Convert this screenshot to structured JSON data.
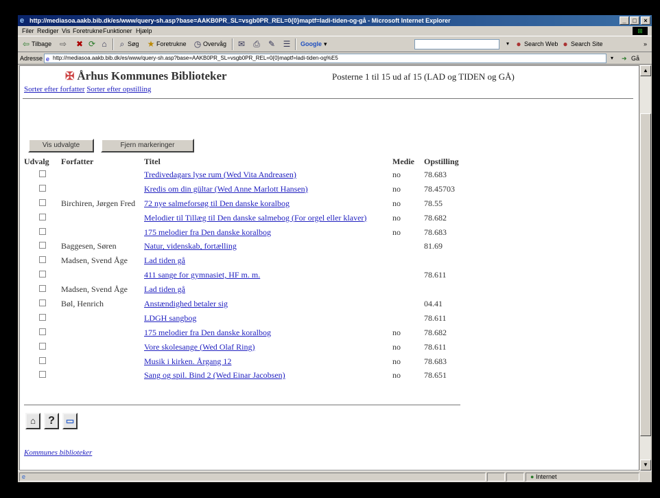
{
  "window": {
    "title": "http://mediasoa.aakb.bib.dk/es/www/query-sh.asp?base=AAKB0PR_SL=vsgb0PR_REL=0{0}maptf=ladi-tiden-og-gå - Microsoft Internet Explorer",
    "min": "_",
    "max": "□",
    "close": "×"
  },
  "menu": [
    "Filer",
    "Rediger",
    "Vis",
    "Foretrukne",
    "Funktioner",
    "Hjælp"
  ],
  "toolbar": {
    "back": "Tilbage",
    "search": "Søg",
    "favorites": "Foretrukne",
    "media": "Overvåg",
    "google": "Google",
    "search_web": "Search Web",
    "search_site": "Search Site"
  },
  "address": {
    "label": "Adresse",
    "url": "http://mediasoa.aakb.bib.dk/es/www/query-sh.asp?base=AAKB0PR_SL=vsgb0PR_REL=0{0}maptf=ladi-tiden-og%E5",
    "go": "Gå"
  },
  "page": {
    "brand": "Århus Kommunes Biblioteker",
    "result_info": "Posterne 1 til 15 ud af 15 (LAD og TIDEN og GÅ)",
    "sort_author": "Sorter efter forfatter",
    "sort_position": "Sorter efter opstilling",
    "btn_show_selected": "Vis udvalgte",
    "btn_remove_marks": "Fjern markeringer",
    "columns": {
      "select": "Udvalg",
      "author": "Forfatter",
      "title": "Titel",
      "media": "Medie",
      "position": "Opstilling"
    },
    "rows": [
      {
        "author": "",
        "title": "Tredivedagars lyse rum (Wed Vita Andreasen)",
        "media": "no",
        "position": "78.683"
      },
      {
        "author": "",
        "title": "Kredis om din gültar (Wed Anne Marlott Hansen)",
        "media": "no",
        "position": "78.45703"
      },
      {
        "author": "Birchiren, Jørgen Fred",
        "title": "72 nye salmeforsøg til Den danske koralbog",
        "media": "no",
        "position": "78.55"
      },
      {
        "author": "",
        "title": "Melodier til Tillæg til Den danske salmebog (For orgel eller klaver)",
        "media": "no",
        "position": "78.682"
      },
      {
        "author": "",
        "title": "175 melodier fra Den danske koralbog",
        "media": "no",
        "position": "78.683"
      },
      {
        "author": "Baggesen, Søren",
        "title": "Natur, videnskab, fortælling",
        "media": "",
        "position": "81.69"
      },
      {
        "author": "Madsen, Svend Åge",
        "title": "Lad tiden gå",
        "media": "",
        "position": ""
      },
      {
        "author": "",
        "title": "411 sange for gymnasiet, HF m. m.",
        "media": "",
        "position": "78.611"
      },
      {
        "author": "Madsen, Svend Åge",
        "title": "Lad tiden gå",
        "media": "",
        "position": ""
      },
      {
        "author": "Bøl, Henrich",
        "title": "Anstændighed betaler sig",
        "media": "",
        "position": "04.41"
      },
      {
        "author": "",
        "title": "LDGH sangbog",
        "media": "",
        "position": "78.611"
      },
      {
        "author": "",
        "title": "175 melodier fra Den danske koralbog",
        "media": "no",
        "position": "78.682"
      },
      {
        "author": "",
        "title": "Vore skolesange (Wed Olaf Ring)",
        "media": "no",
        "position": "78.611"
      },
      {
        "author": "",
        "title": "Musik i kirken. Årgang 12",
        "media": "no",
        "position": "78.683"
      },
      {
        "author": "",
        "title": "Sang og spil. Bind 2 (Wed Einar Jacobsen)",
        "media": "no",
        "position": "78.651"
      }
    ],
    "footer_link": "Kommunes biblioteker"
  },
  "status": {
    "zone": "Internet"
  },
  "colors": {
    "titlebar": "#0a246a",
    "link": "#2020c0",
    "chrome": "#d4d0c8"
  }
}
